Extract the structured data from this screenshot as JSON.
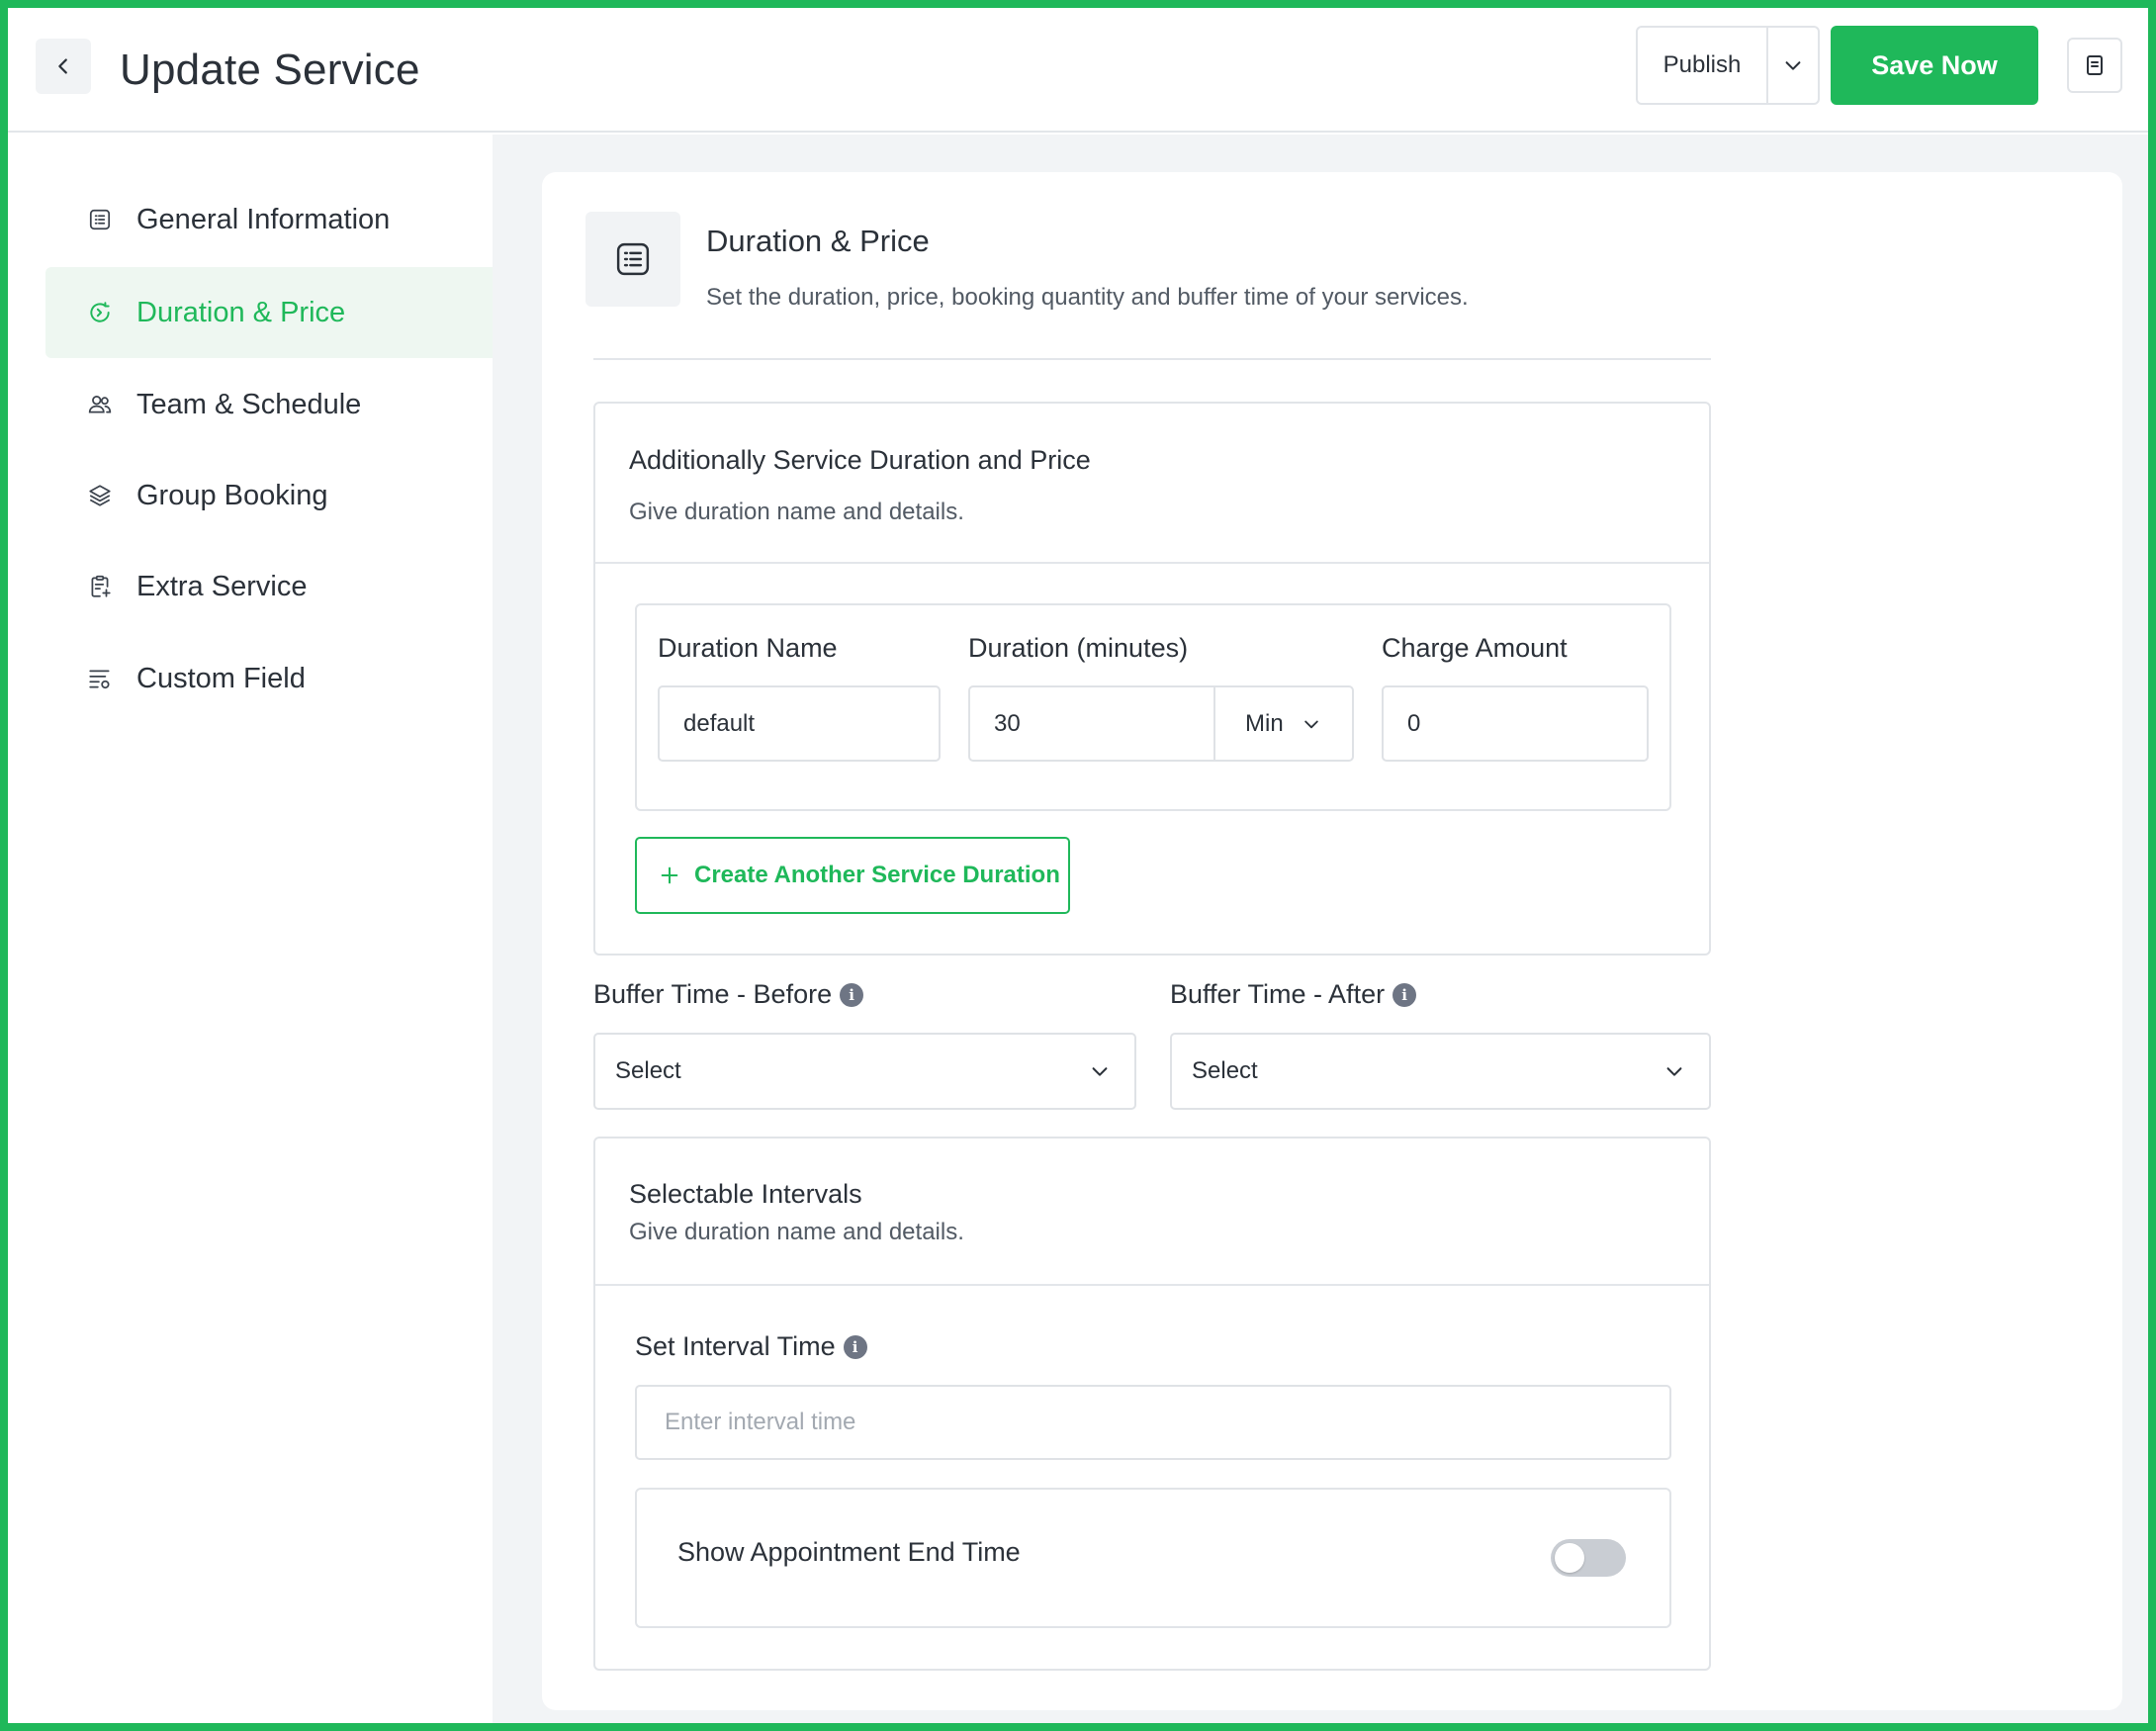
{
  "header": {
    "title": "Update Service",
    "publish_label": "Publish",
    "save_label": "Save Now"
  },
  "sidebar": {
    "items": [
      {
        "label": "General Information",
        "icon": "list-icon",
        "active": false
      },
      {
        "label": "Duration & Price",
        "icon": "clock-arrow-icon",
        "active": true
      },
      {
        "label": "Team & Schedule",
        "icon": "users-icon",
        "active": false
      },
      {
        "label": "Group Booking",
        "icon": "layers-icon",
        "active": false
      },
      {
        "label": "Extra Service",
        "icon": "clipboard-plus-icon",
        "active": false
      },
      {
        "label": "Custom Field",
        "icon": "list-settings-icon",
        "active": false
      }
    ]
  },
  "section": {
    "title": "Duration & Price",
    "description": "Set the duration, price, booking quantity and buffer time of your services."
  },
  "additional": {
    "title": "Additionally Service Duration and Price",
    "subtitle": "Give duration name and details.",
    "labels": {
      "duration_name": "Duration Name",
      "duration_minutes": "Duration (minutes)",
      "charge_amount": "Charge Amount"
    },
    "values": {
      "duration_name": "default",
      "duration_minutes": "30",
      "unit": "Min",
      "charge_amount": "0"
    },
    "create_button": "Create Another Service Duration"
  },
  "buffer": {
    "before_label": "Buffer Time - Before",
    "after_label": "Buffer Time - After",
    "before_value": "Select",
    "after_value": "Select"
  },
  "intervals": {
    "title": "Selectable Intervals",
    "subtitle": "Give duration name and details.",
    "interval_label": "Set Interval Time",
    "interval_placeholder": "Enter interval time",
    "toggle_label": "Show Appointment End Time",
    "toggle_on": false
  },
  "colors": {
    "accent": "#1fb85a",
    "active_bg": "#eef7f1"
  }
}
